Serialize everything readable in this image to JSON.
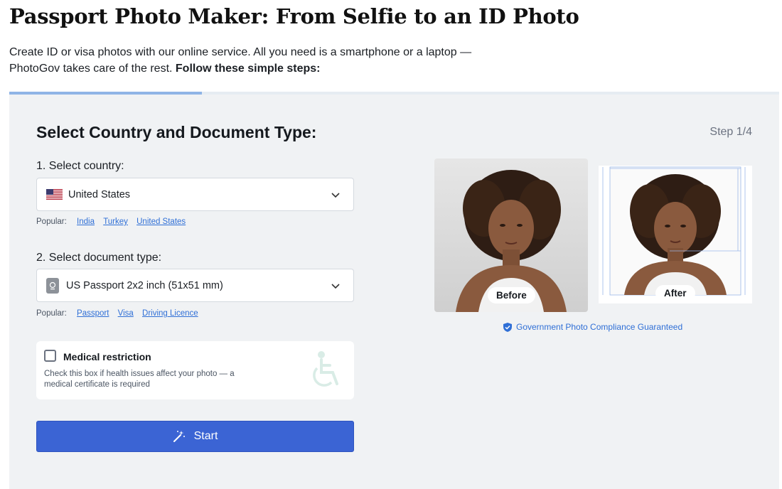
{
  "header": {
    "title": "Passport Photo Maker: From Selfie to an ID Photo",
    "intro_text": "Create ID or visa photos with our online service. All you need is a smartphone or a laptop — PhotoGov takes care of the rest.",
    "intro_bold": "Follow these simple steps:"
  },
  "progress": {
    "fraction": 0.25
  },
  "form": {
    "section_title": "Select Country and Document Type:",
    "step": "Step 1/4",
    "country_label": "1. Select country:",
    "country_value": "United States",
    "country_flag_icon": "us-flag-icon",
    "popular_label": "Popular:",
    "popular_countries": [
      "India",
      "Turkey",
      "United States"
    ],
    "document_label": "2. Select document type:",
    "document_value": "US Passport 2x2 inch (51x51 mm)",
    "popular_documents": [
      "Passport",
      "Visa",
      "Driving Licence"
    ],
    "medical": {
      "title": "Medical restriction",
      "description": "Check this box if health issues affect your photo — a medical certificate is required",
      "checked": false
    },
    "start_label": "Start"
  },
  "preview": {
    "before_label": "Before",
    "after_label": "After",
    "compliance": "Government Photo Compliance Guaranteed"
  },
  "colors": {
    "accent": "#3b64d4",
    "link": "#2f6fd6",
    "panel": "#f0f2f4"
  }
}
